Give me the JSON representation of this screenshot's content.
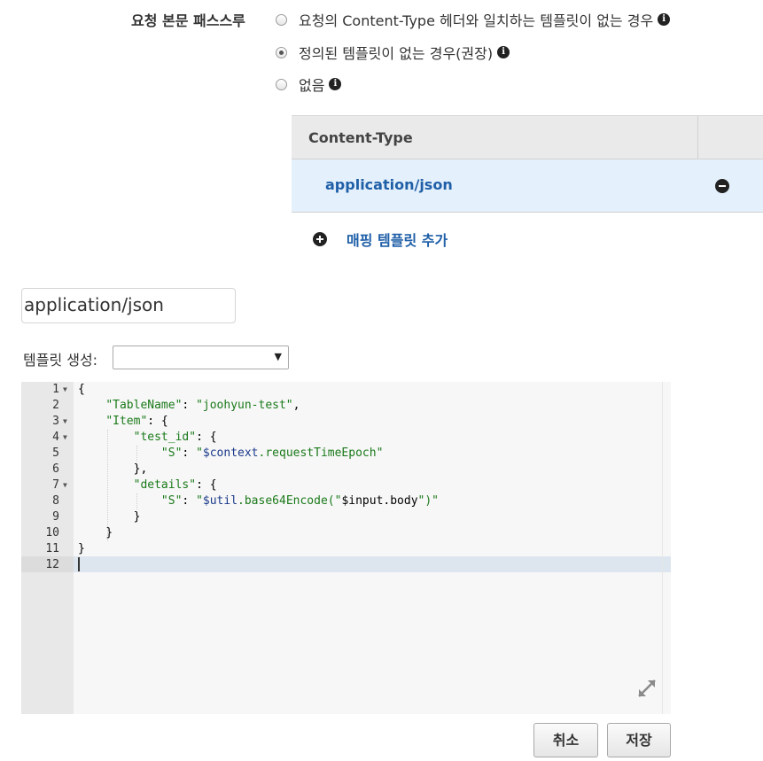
{
  "passthrough": {
    "label": "요청 본문 패스스루",
    "options": [
      {
        "label": "요청의 Content-Type 헤더와 일치하는 템플릿이 없는 경우",
        "checked": false
      },
      {
        "label": "정의된 템플릿이 없는 경우(권장)",
        "checked": true
      },
      {
        "label": "없음",
        "checked": false
      }
    ],
    "info_icon": "info-circle-icon"
  },
  "content_type_table": {
    "header": "Content-Type",
    "rows": [
      {
        "value": "application/json"
      }
    ],
    "remove_icon": "minus-circle-icon"
  },
  "add_mapping": {
    "label": "매핑 템플릿 추가",
    "icon": "plus-circle-icon"
  },
  "content_type_input": {
    "value": "application/json"
  },
  "template_generation": {
    "label": "템플릿 생성:",
    "selected": ""
  },
  "editor": {
    "line_numbers": [
      "1",
      "2",
      "3",
      "4",
      "5",
      "6",
      "7",
      "8",
      "9",
      "10",
      "11",
      "12"
    ],
    "folding_lines": [
      1,
      3,
      4,
      7
    ],
    "active_line": 12,
    "lines": [
      "{",
      "    \"TableName\": \"joohyun-test\",",
      "    \"Item\": {",
      "        \"test_id\": {",
      "            \"S\": \"$context.requestTimeEpoch\"",
      "        },",
      "        \"details\": {",
      "            \"S\": \"$util.base64Encode(\"$input.body\")\"",
      "        }",
      "    }",
      "}",
      ""
    ],
    "expand_icon": "expand-arrows-icon"
  },
  "buttons": {
    "cancel": "취소",
    "save": "저장"
  },
  "colors": {
    "link": "#1f5fa8",
    "selected_row": "#e4f0fb",
    "string": "#1a7a1a",
    "variable": "#1a3a8a"
  }
}
